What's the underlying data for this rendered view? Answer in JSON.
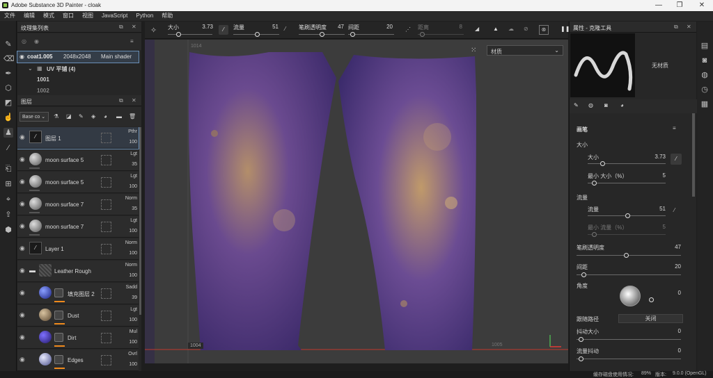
{
  "window": {
    "title": "Adobe Substance 3D Painter - cloak"
  },
  "menu": [
    "文件",
    "编辑",
    "模式",
    "窗口",
    "视图",
    "JavaScript",
    "Python",
    "帮助"
  ],
  "texture_set_list": {
    "title": "纹理集列表",
    "item": {
      "name": "coat1.005",
      "size": "2048x2048",
      "shader": "Main shader"
    },
    "uv_group": "UV 平铺 (4)",
    "tiles": [
      "1001",
      "1002"
    ]
  },
  "layers_panel": {
    "title": "图层",
    "channel": "Base co",
    "layers": [
      {
        "name": "图层 1",
        "blend": "Pthr",
        "opacity": "100"
      },
      {
        "name": "moon surface 5",
        "blend": "Lgt",
        "opacity": "35"
      },
      {
        "name": "moon surface 5",
        "blend": "Lgt",
        "opacity": "100"
      },
      {
        "name": "moon surface 7",
        "blend": "Norm",
        "opacity": "35"
      },
      {
        "name": "moon surface 7",
        "blend": "Lgt",
        "opacity": "100"
      },
      {
        "name": "Layer 1",
        "blend": "Norm",
        "opacity": "100"
      },
      {
        "name": "Leather Rough",
        "blend": "Norm",
        "opacity": "100"
      },
      {
        "name": "填充图层 2",
        "blend": "Sadd",
        "opacity": "39"
      },
      {
        "name": "Dust",
        "blend": "Lgt",
        "opacity": "100"
      },
      {
        "name": "Dirt",
        "blend": "Mul",
        "opacity": "100"
      },
      {
        "name": "Edges",
        "blend": "Ovrl",
        "opacity": "100"
      }
    ]
  },
  "toolbar": {
    "size_label": "大小",
    "size_value": "3.73",
    "flow_label": "流量",
    "flow_value": "51",
    "opacity_label": "笔刷透明度",
    "opacity_value": "47",
    "spacing_label": "间距",
    "spacing_value": "20",
    "distance_label": "距离",
    "distance_value": "8"
  },
  "viewport": {
    "material_dropdown": "材质",
    "uv_label_left": "1004",
    "uv_label_right": "1005",
    "uv_label_top": "1014"
  },
  "properties": {
    "title": "属性 - 克隆工具",
    "no_material": "无材质",
    "section_brush": "画笔",
    "size_group": "大小",
    "size_label": "大小",
    "size_value": "3.73",
    "min_size_label": "最小 大小（%）",
    "min_size_value": "5",
    "flow_group": "流量",
    "flow_label": "流量",
    "flow_value": "51",
    "min_flow_label": "最小 流量（%）",
    "min_flow_value": "5",
    "stroke_opacity_label": "笔刷透明度",
    "stroke_opacity_value": "47",
    "spacing_label": "间距",
    "spacing_value": "20",
    "angle_label": "角度",
    "angle_value": "0",
    "follow_path_label": "跟随路径",
    "follow_path_value": "关闭",
    "jitter_size_label": "抖动大小",
    "jitter_size_value": "0",
    "flow_jitter_label": "流量抖动",
    "flow_jitter_value": "0"
  },
  "status": {
    "text": "缓存磁盘使用情况:",
    "percent": "89%",
    "version_label": "版本:",
    "version": "9.0.0 (OpenGL)"
  },
  "colors": {
    "accent": "#f08a1c",
    "selection": "#6a8fb7",
    "fabric": "#5a3f8e"
  }
}
